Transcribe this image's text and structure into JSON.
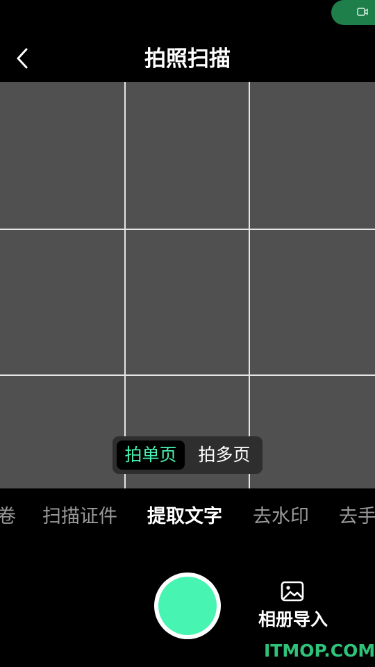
{
  "colors": {
    "accent": "#47f4b2",
    "viewfinder_bg": "#505050",
    "status_pill": "#1f7f4a",
    "watermark": "#2fc37a"
  },
  "status_bar": {
    "icon": "video-camera-icon"
  },
  "header": {
    "back_icon": "chevron-left-icon",
    "title": "拍照扫描"
  },
  "mode_toggle": {
    "options": [
      "拍单页",
      "拍多页"
    ],
    "selected": "拍单页"
  },
  "function_tabs": {
    "items": [
      "卷",
      "扫描证件",
      "提取文字",
      "去水印",
      "去手"
    ],
    "active": "提取文字"
  },
  "bottom": {
    "shutter_icon": "shutter-button",
    "album_icon": "image-icon",
    "album_label": "相册导入"
  },
  "watermark": {
    "text": "ITMOP.COM"
  }
}
